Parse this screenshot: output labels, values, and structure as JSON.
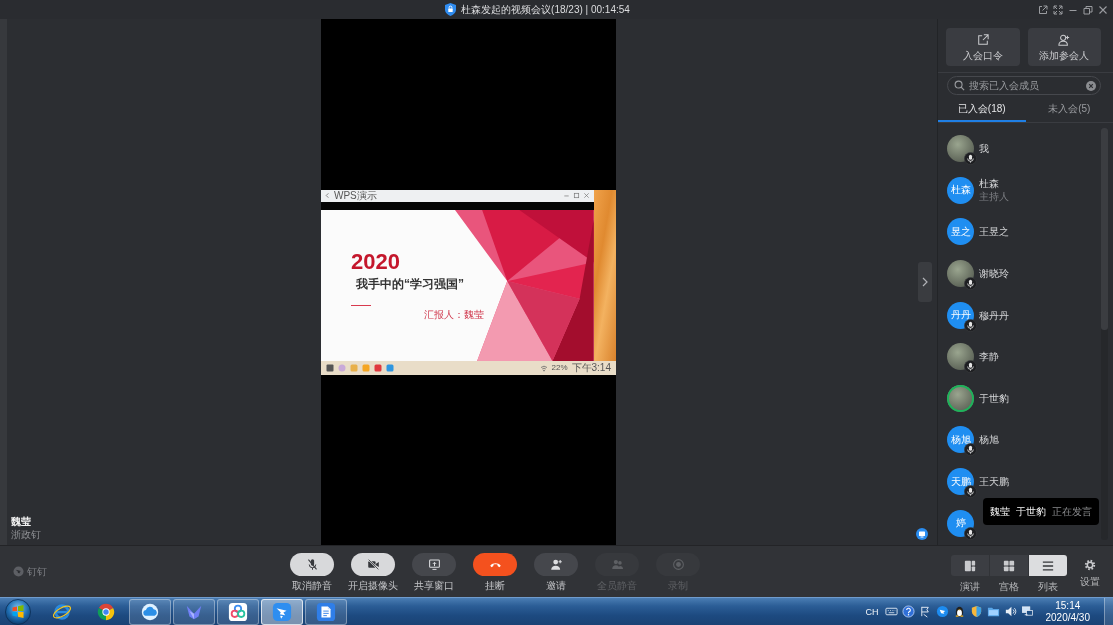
{
  "window": {
    "title": "杜森发起的视频会议(18/23) | 00:14:54"
  },
  "stage": {
    "presenter": {
      "name": "魏莹",
      "org": "浙政钉"
    },
    "shared_screen": {
      "window_title": "WPS演示",
      "slide": {
        "year": "2020",
        "title": "我手中的“学习强国”",
        "presenter": "汇报人：魏莹"
      },
      "taskbar": {
        "battery": "22%",
        "clock": "下午3:14"
      }
    }
  },
  "sidebar": {
    "actions": [
      {
        "kind": "link",
        "label": "入会口令"
      },
      {
        "kind": "add-person",
        "label": "添加参会人"
      }
    ],
    "search": {
      "placeholder": "搜索已入会成员"
    },
    "tabs": [
      {
        "label": "已入会(18)",
        "selected": true
      },
      {
        "label": "未入会(5)",
        "selected": false
      }
    ],
    "members": [
      {
        "name": "我",
        "avatar": {
          "kind": "photo"
        },
        "muted": true,
        "speaking": false
      },
      {
        "name": "杜森",
        "role": "主持人",
        "avatar": {
          "kind": "initials",
          "text": "杜森"
        },
        "muted": false,
        "speaking": false
      },
      {
        "name": "王昱之",
        "avatar": {
          "kind": "initials",
          "text": "昱之"
        },
        "muted": false,
        "speaking": false
      },
      {
        "name": "谢晓玲",
        "avatar": {
          "kind": "photo"
        },
        "muted": true,
        "speaking": false
      },
      {
        "name": "穆丹丹",
        "avatar": {
          "kind": "initials",
          "text": "丹丹"
        },
        "muted": true,
        "speaking": false
      },
      {
        "name": "李静",
        "avatar": {
          "kind": "photo"
        },
        "muted": true,
        "speaking": false
      },
      {
        "name": "于世豹",
        "avatar": {
          "kind": "photo"
        },
        "muted": false,
        "speaking": true
      },
      {
        "name": "杨旭",
        "avatar": {
          "kind": "initials",
          "text": "杨旭"
        },
        "muted": true,
        "speaking": false
      },
      {
        "name": "王天鹏",
        "avatar": {
          "kind": "initials",
          "text": "天鹏"
        },
        "muted": true,
        "speaking": false
      },
      {
        "avatar": {
          "kind": "initials",
          "text": "婷"
        },
        "muted": true,
        "speaking": false
      }
    ],
    "speaking_notice": {
      "names": [
        "魏莹",
        "于世豹"
      ],
      "status": "正在发言"
    }
  },
  "toolbar": {
    "brand": "钉钉",
    "controls": [
      {
        "label": "取消静音",
        "kind": "mic",
        "off": true,
        "disabled": false
      },
      {
        "label": "开启摄像头",
        "kind": "camera",
        "off": true,
        "disabled": false
      },
      {
        "label": "共享窗口",
        "kind": "share",
        "off": false,
        "disabled": false
      },
      {
        "label": "挂断",
        "kind": "hangup",
        "off": false,
        "disabled": false
      },
      {
        "label": "邀请",
        "kind": "invite",
        "off": false,
        "disabled": false
      },
      {
        "label": "全员静音",
        "kind": "mute-all",
        "off": false,
        "disabled": true
      },
      {
        "label": "录制",
        "kind": "record",
        "off": false,
        "disabled": true
      }
    ],
    "views": [
      {
        "label": "演讲",
        "kind": "speaker",
        "selected": false
      },
      {
        "label": "宫格",
        "kind": "grid",
        "selected": false
      },
      {
        "label": "列表",
        "kind": "list",
        "selected": true
      }
    ],
    "settings": "设置"
  },
  "taskbar": {
    "apps": [
      {
        "kind": "globe",
        "running": false,
        "selected": false
      },
      {
        "kind": "tricolor",
        "running": false,
        "selected": false
      },
      {
        "kind": "cloud",
        "running": true,
        "selected": false
      },
      {
        "kind": "bird",
        "running": true,
        "selected": false
      },
      {
        "kind": "petals",
        "running": true,
        "selected": false
      },
      {
        "kind": "wing",
        "running": true,
        "selected": true
      },
      {
        "kind": "document",
        "running": true,
        "selected": false
      }
    ],
    "tray": {
      "language": "CH",
      "time": "15:14",
      "date": "2020/4/30"
    }
  }
}
